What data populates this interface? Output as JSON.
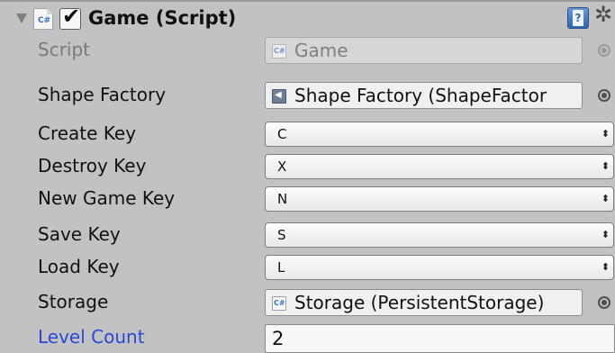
{
  "component": {
    "title": "Game (Script)",
    "enabled": true,
    "icons": {
      "foldout": "foldout-expanded-triangle-icon",
      "script": "csharp-script-icon",
      "help": "help-book-icon",
      "settings": "gear-icon"
    },
    "glyphs": {
      "checkmark": "✔",
      "script_icon": "C#",
      "prefab_icon": "◀",
      "help": "?",
      "gear": "✲",
      "dropdown_arrow": "⬍"
    }
  },
  "fields": {
    "script": {
      "label": "Script",
      "value": "Game",
      "disabled": true
    },
    "shape_factory": {
      "label": "Shape Factory",
      "value": "Shape Factory (ShapeFactor"
    },
    "create_key": {
      "label": "Create Key",
      "value": "C"
    },
    "destroy_key": {
      "label": "Destroy Key",
      "value": "X"
    },
    "new_game_key": {
      "label": "New Game Key",
      "value": "N"
    },
    "save_key": {
      "label": "Save Key",
      "value": "S"
    },
    "load_key": {
      "label": "Load Key",
      "value": "L"
    },
    "storage": {
      "label": "Storage",
      "value": "Storage (PersistentStorage)"
    },
    "level_count": {
      "label": "Level Count",
      "value": "2",
      "modified": true
    }
  },
  "colors": {
    "panel_background": "#c2c2c2",
    "modified_label": "#2948d6",
    "disabled_text": "#7a7a7a"
  }
}
